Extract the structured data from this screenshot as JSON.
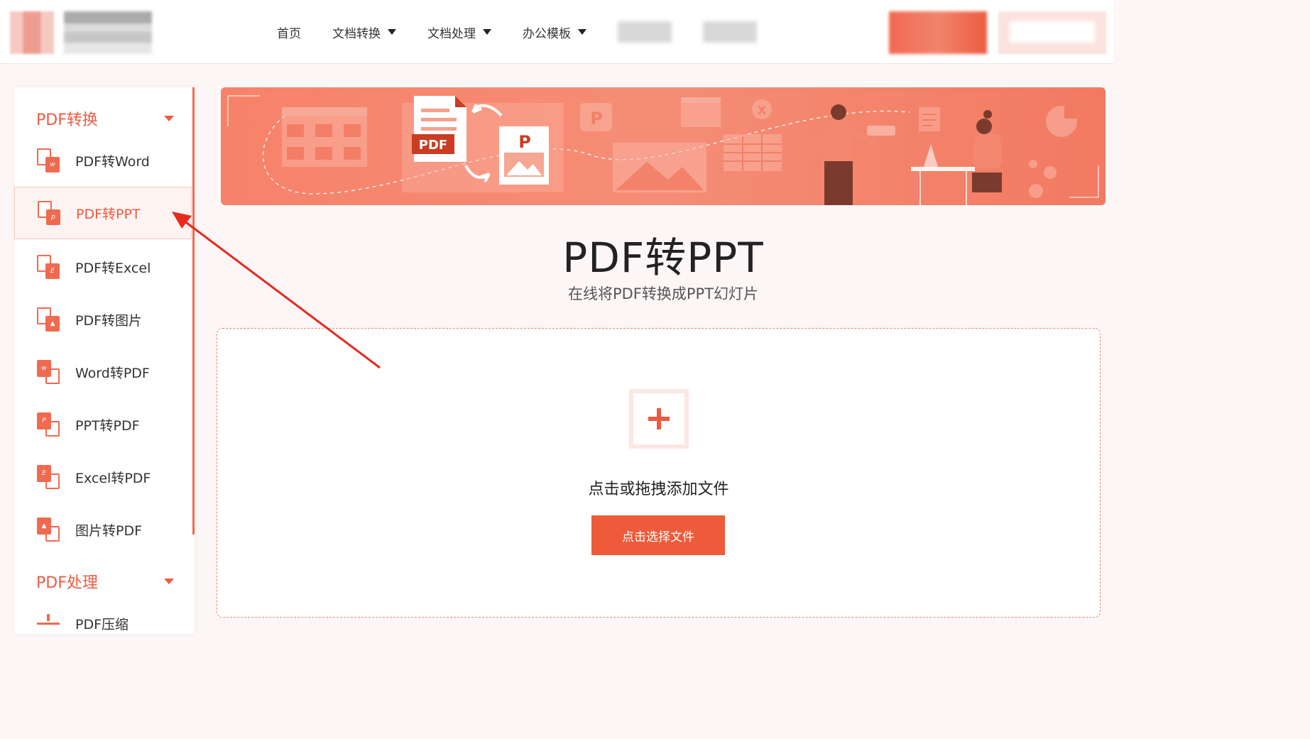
{
  "nav": {
    "home": "首页",
    "doc_convert": "文档转换",
    "doc_process": "文档处理",
    "office_templates": "办公模板"
  },
  "sidebar": {
    "cat_convert": "PDF转换",
    "cat_process": "PDF处理",
    "items": [
      {
        "label": "PDF转Word",
        "badge": "w"
      },
      {
        "label": "PDF转PPT",
        "badge": "p"
      },
      {
        "label": "PDF转Excel",
        "badge": "E"
      },
      {
        "label": "PDF转图片",
        "badge": "▲"
      },
      {
        "label": "Word转PDF",
        "badge": "w"
      },
      {
        "label": "PPT转PDF",
        "badge": "P"
      },
      {
        "label": "Excel转PDF",
        "badge": "E"
      },
      {
        "label": "图片转PDF",
        "badge": "▲"
      }
    ],
    "compress": "PDF压缩"
  },
  "banner": {
    "pdf_tag": "PDF",
    "ppt_letter": "P",
    "ppt_letter_small": "P",
    "excel_letter": "X"
  },
  "main": {
    "title": "PDF转PPT",
    "subtitle": "在线将PDF转换成PPT幻灯片",
    "upload_hint": "点击或拖拽添加文件",
    "choose_button": "点击选择文件"
  },
  "colors": {
    "accent": "#ee5a40",
    "banner": "#f5826a"
  }
}
